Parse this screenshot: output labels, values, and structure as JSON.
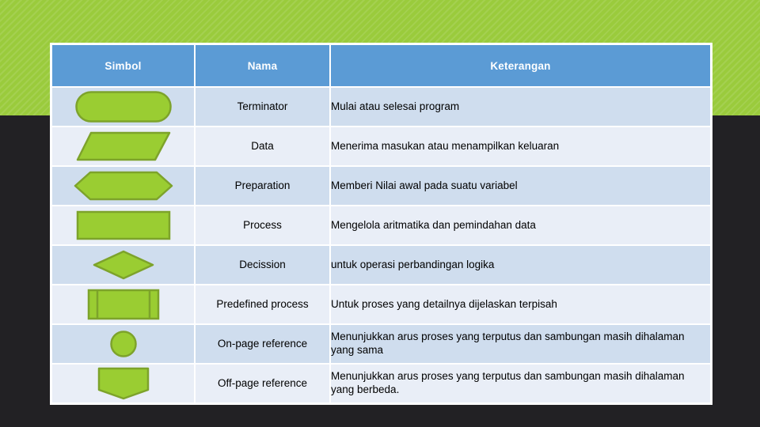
{
  "banner": {
    "accent_color": "#9ACB3C"
  },
  "page": {
    "background_color": "#222124"
  },
  "table": {
    "header_color": "#5B9BD5",
    "symbol_fill": "#9ACD32",
    "symbol_stroke": "#7DA32B",
    "row_color_odd": "#CFDDEE",
    "row_color_even": "#E9EEF7",
    "headers": {
      "symbol": "Simbol",
      "name": "Nama",
      "description": "Keterangan"
    },
    "rows": [
      {
        "symbol_icon": "terminator-shape",
        "name": "Terminator",
        "description": "Mulai atau selesai program"
      },
      {
        "symbol_icon": "data-parallelogram-shape",
        "name": "Data",
        "description": "Menerima masukan atau menampilkan keluaran"
      },
      {
        "symbol_icon": "preparation-hexagon-shape",
        "name": "Preparation",
        "description": "Memberi Nilai awal pada suatu variabel"
      },
      {
        "symbol_icon": "process-rectangle-shape",
        "name": "Process",
        "description": "Mengelola aritmatika dan pemindahan data"
      },
      {
        "symbol_icon": "decision-diamond-shape",
        "name": "Decission",
        "description": "untuk operasi perbandingan logika"
      },
      {
        "symbol_icon": "predefined-process-shape",
        "name": "Predefined process",
        "description": "Untuk proses yang detailnya dijelaskan terpisah"
      },
      {
        "symbol_icon": "on-page-reference-circle-shape",
        "name": "On-page reference",
        "description": "Menunjukkan arus proses yang terputus dan sambungan masih dihalaman yang sama"
      },
      {
        "symbol_icon": "off-page-reference-pentagon-shape",
        "name": "Off-page reference",
        "description": "Menunjukkan arus proses yang terputus dan sambungan masih dihalaman yang berbeda."
      }
    ]
  }
}
